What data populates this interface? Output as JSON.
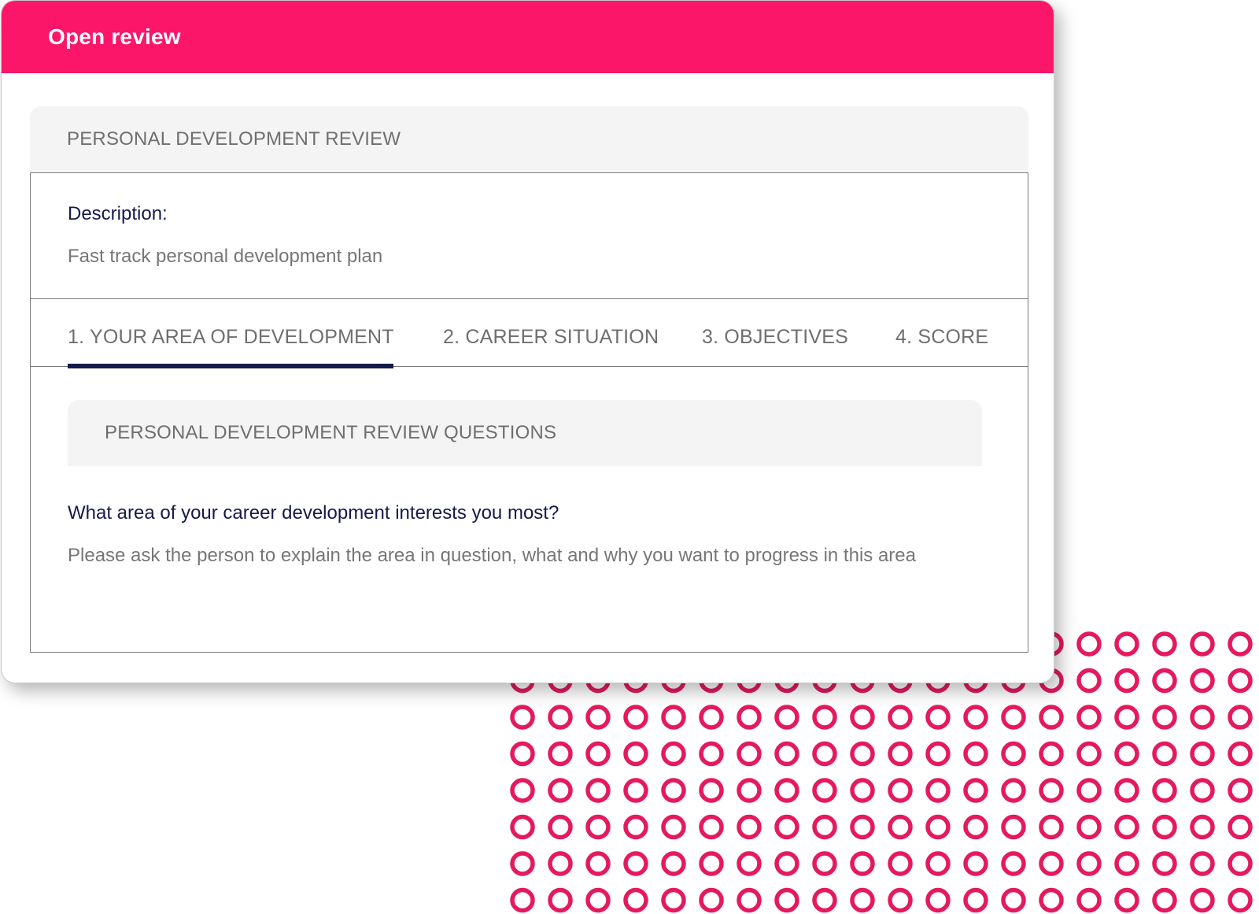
{
  "window": {
    "title": "Open review",
    "header_color": "#fc166a"
  },
  "review": {
    "panel_title": "PERSONAL DEVELOPMENT REVIEW",
    "description_label": "Description:",
    "description_value": "Fast track personal development plan"
  },
  "tabs": [
    {
      "label": "1. YOUR AREA OF DEVELOPMENT",
      "active": true
    },
    {
      "label": "2. CAREER SITUATION",
      "active": false
    },
    {
      "label": "3. OBJECTIVES",
      "active": false
    },
    {
      "label": "4. SCORE",
      "active": false
    }
  ],
  "questions": {
    "section_title": "PERSONAL DEVELOPMENT REVIEW QUESTIONS",
    "question": "What area of your career development interests you most?",
    "hint": "Please ask the person to explain the area in question, what and why you want to progress in this area"
  },
  "colors": {
    "accent": "#fc166a",
    "navy": "#141a4a",
    "muted_text": "#767676",
    "panel_bg": "#f4f4f4",
    "ring": "#e5195f"
  },
  "decoration": {
    "icon": "ring-pattern"
  }
}
